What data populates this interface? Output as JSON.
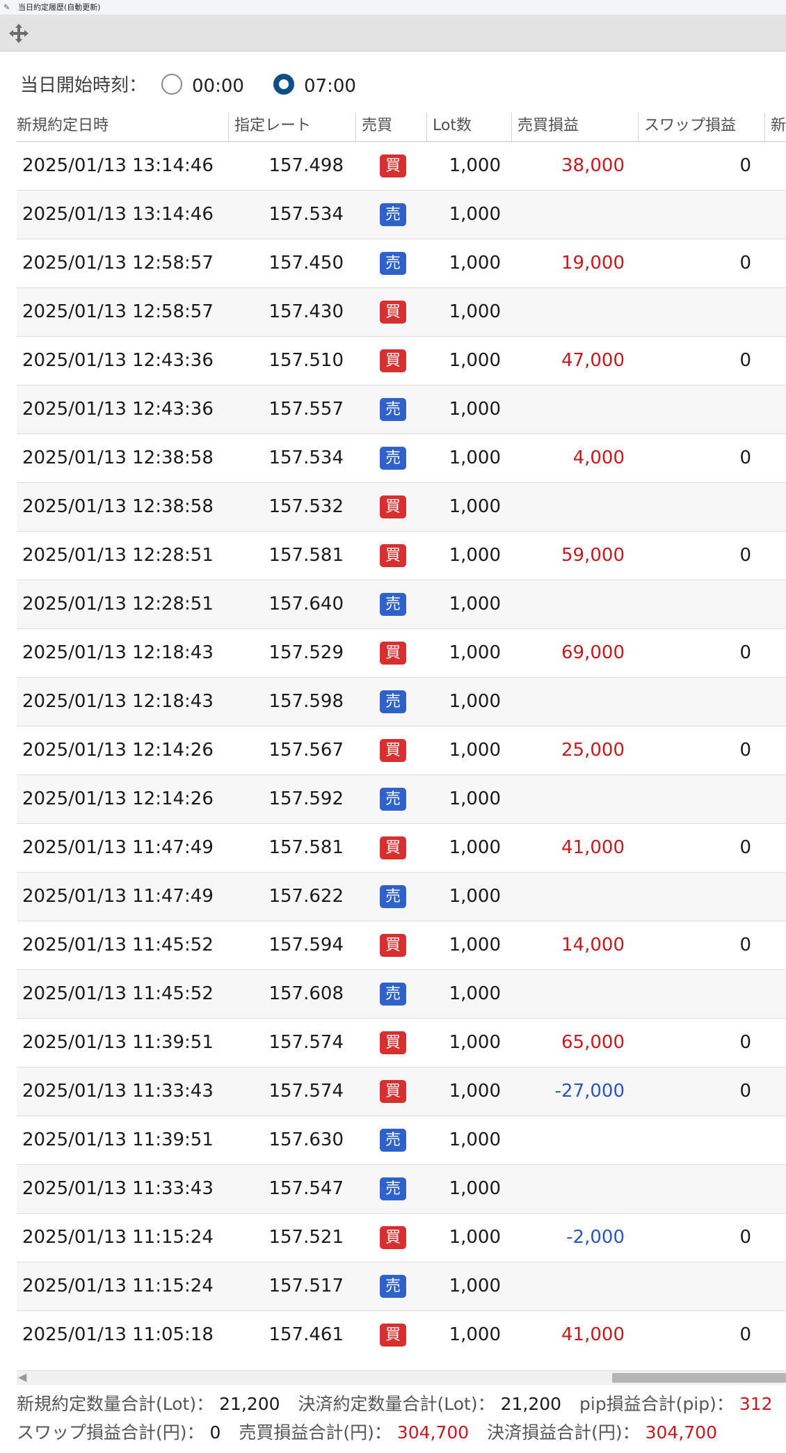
{
  "window": {
    "title": "当日約定履歴(自動更新)"
  },
  "start_time": {
    "label": "当日開始時刻：",
    "options": [
      {
        "label": "00:00",
        "selected": false
      },
      {
        "label": "07:00",
        "selected": true
      }
    ]
  },
  "table": {
    "columns": [
      "新規約定日時",
      "指定レート",
      "売買",
      "Lot数",
      "売買損益",
      "スワップ損益",
      "新"
    ],
    "rows": [
      {
        "datetime": "2025/01/13 13:14:46",
        "rate": "157.498",
        "side": "買",
        "lot": "1,000",
        "pnl": "38,000",
        "swap": "0"
      },
      {
        "datetime": "2025/01/13 13:14:46",
        "rate": "157.534",
        "side": "売",
        "lot": "1,000",
        "pnl": "",
        "swap": ""
      },
      {
        "datetime": "2025/01/13 12:58:57",
        "rate": "157.450",
        "side": "売",
        "lot": "1,000",
        "pnl": "19,000",
        "swap": "0"
      },
      {
        "datetime": "2025/01/13 12:58:57",
        "rate": "157.430",
        "side": "買",
        "lot": "1,000",
        "pnl": "",
        "swap": ""
      },
      {
        "datetime": "2025/01/13 12:43:36",
        "rate": "157.510",
        "side": "買",
        "lot": "1,000",
        "pnl": "47,000",
        "swap": "0"
      },
      {
        "datetime": "2025/01/13 12:43:36",
        "rate": "157.557",
        "side": "売",
        "lot": "1,000",
        "pnl": "",
        "swap": ""
      },
      {
        "datetime": "2025/01/13 12:38:58",
        "rate": "157.534",
        "side": "売",
        "lot": "1,000",
        "pnl": "4,000",
        "swap": "0"
      },
      {
        "datetime": "2025/01/13 12:38:58",
        "rate": "157.532",
        "side": "買",
        "lot": "1,000",
        "pnl": "",
        "swap": ""
      },
      {
        "datetime": "2025/01/13 12:28:51",
        "rate": "157.581",
        "side": "買",
        "lot": "1,000",
        "pnl": "59,000",
        "swap": "0"
      },
      {
        "datetime": "2025/01/13 12:28:51",
        "rate": "157.640",
        "side": "売",
        "lot": "1,000",
        "pnl": "",
        "swap": ""
      },
      {
        "datetime": "2025/01/13 12:18:43",
        "rate": "157.529",
        "side": "買",
        "lot": "1,000",
        "pnl": "69,000",
        "swap": "0"
      },
      {
        "datetime": "2025/01/13 12:18:43",
        "rate": "157.598",
        "side": "売",
        "lot": "1,000",
        "pnl": "",
        "swap": ""
      },
      {
        "datetime": "2025/01/13 12:14:26",
        "rate": "157.567",
        "side": "買",
        "lot": "1,000",
        "pnl": "25,000",
        "swap": "0"
      },
      {
        "datetime": "2025/01/13 12:14:26",
        "rate": "157.592",
        "side": "売",
        "lot": "1,000",
        "pnl": "",
        "swap": ""
      },
      {
        "datetime": "2025/01/13 11:47:49",
        "rate": "157.581",
        "side": "買",
        "lot": "1,000",
        "pnl": "41,000",
        "swap": "0"
      },
      {
        "datetime": "2025/01/13 11:47:49",
        "rate": "157.622",
        "side": "売",
        "lot": "1,000",
        "pnl": "",
        "swap": ""
      },
      {
        "datetime": "2025/01/13 11:45:52",
        "rate": "157.594",
        "side": "買",
        "lot": "1,000",
        "pnl": "14,000",
        "swap": "0"
      },
      {
        "datetime": "2025/01/13 11:45:52",
        "rate": "157.608",
        "side": "売",
        "lot": "1,000",
        "pnl": "",
        "swap": ""
      },
      {
        "datetime": "2025/01/13 11:39:51",
        "rate": "157.574",
        "side": "買",
        "lot": "1,000",
        "pnl": "65,000",
        "swap": "0"
      },
      {
        "datetime": "2025/01/13 11:33:43",
        "rate": "157.574",
        "side": "買",
        "lot": "1,000",
        "pnl": "-27,000",
        "swap": "0"
      },
      {
        "datetime": "2025/01/13 11:39:51",
        "rate": "157.630",
        "side": "売",
        "lot": "1,000",
        "pnl": "",
        "swap": ""
      },
      {
        "datetime": "2025/01/13 11:33:43",
        "rate": "157.547",
        "side": "売",
        "lot": "1,000",
        "pnl": "",
        "swap": ""
      },
      {
        "datetime": "2025/01/13 11:15:24",
        "rate": "157.521",
        "side": "買",
        "lot": "1,000",
        "pnl": "-2,000",
        "swap": "0"
      },
      {
        "datetime": "2025/01/13 11:15:24",
        "rate": "157.517",
        "side": "売",
        "lot": "1,000",
        "pnl": "",
        "swap": ""
      },
      {
        "datetime": "2025/01/13 11:05:18",
        "rate": "157.461",
        "side": "買",
        "lot": "1,000",
        "pnl": "41,000",
        "swap": "0"
      }
    ]
  },
  "summary": {
    "new_lot_label": "新規約定数量合計(Lot)：",
    "new_lot_value": "21,200",
    "settle_lot_label": "決済約定数量合計(Lot)：",
    "settle_lot_value": "21,200",
    "pip_label": "pip損益合計(pip)：",
    "pip_value": "312",
    "swap_label": "スワップ損益合計(円)：",
    "swap_value": "0",
    "trade_pnl_label": "売買損益合計(円)：",
    "trade_pnl_value": "304,700",
    "settle_pnl_label": "決済損益合計(円)：",
    "settle_pnl_value": "304,700"
  },
  "colors": {
    "buy_badge": "#d63031",
    "sell_badge": "#2f62c9",
    "profit_text": "#c8191e",
    "loss_text": "#2b55c0",
    "radio_selected": "#0d4f86"
  },
  "icons": [
    "app-icon",
    "move-icon",
    "scroll-left-icon"
  ]
}
